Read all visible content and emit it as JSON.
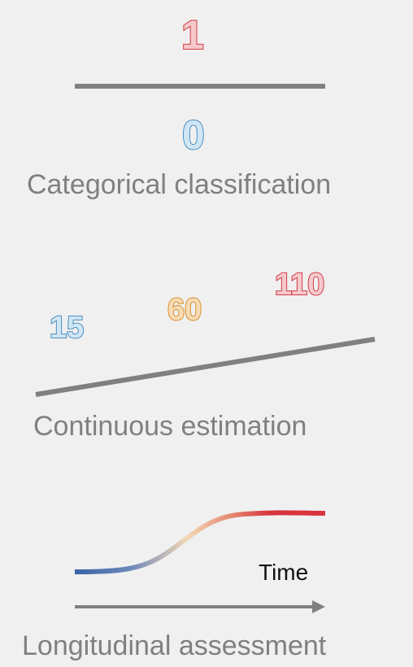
{
  "categorical": {
    "top_value": "1",
    "bottom_value": "0",
    "caption": "Categorical classification"
  },
  "continuous": {
    "values": [
      "15",
      "60",
      "110"
    ],
    "caption": "Continuous estimation"
  },
  "longitudinal": {
    "axis_label": "Time",
    "caption": "Longitudinal assessment"
  },
  "colors": {
    "red": "#d23a44",
    "blue": "#4a8fc0",
    "orange": "#d78e2c",
    "line_gray": "#808080",
    "curve_start": "#3a64a6",
    "curve_mid": "#f3d8b6",
    "curve_end": "#d8333e"
  }
}
